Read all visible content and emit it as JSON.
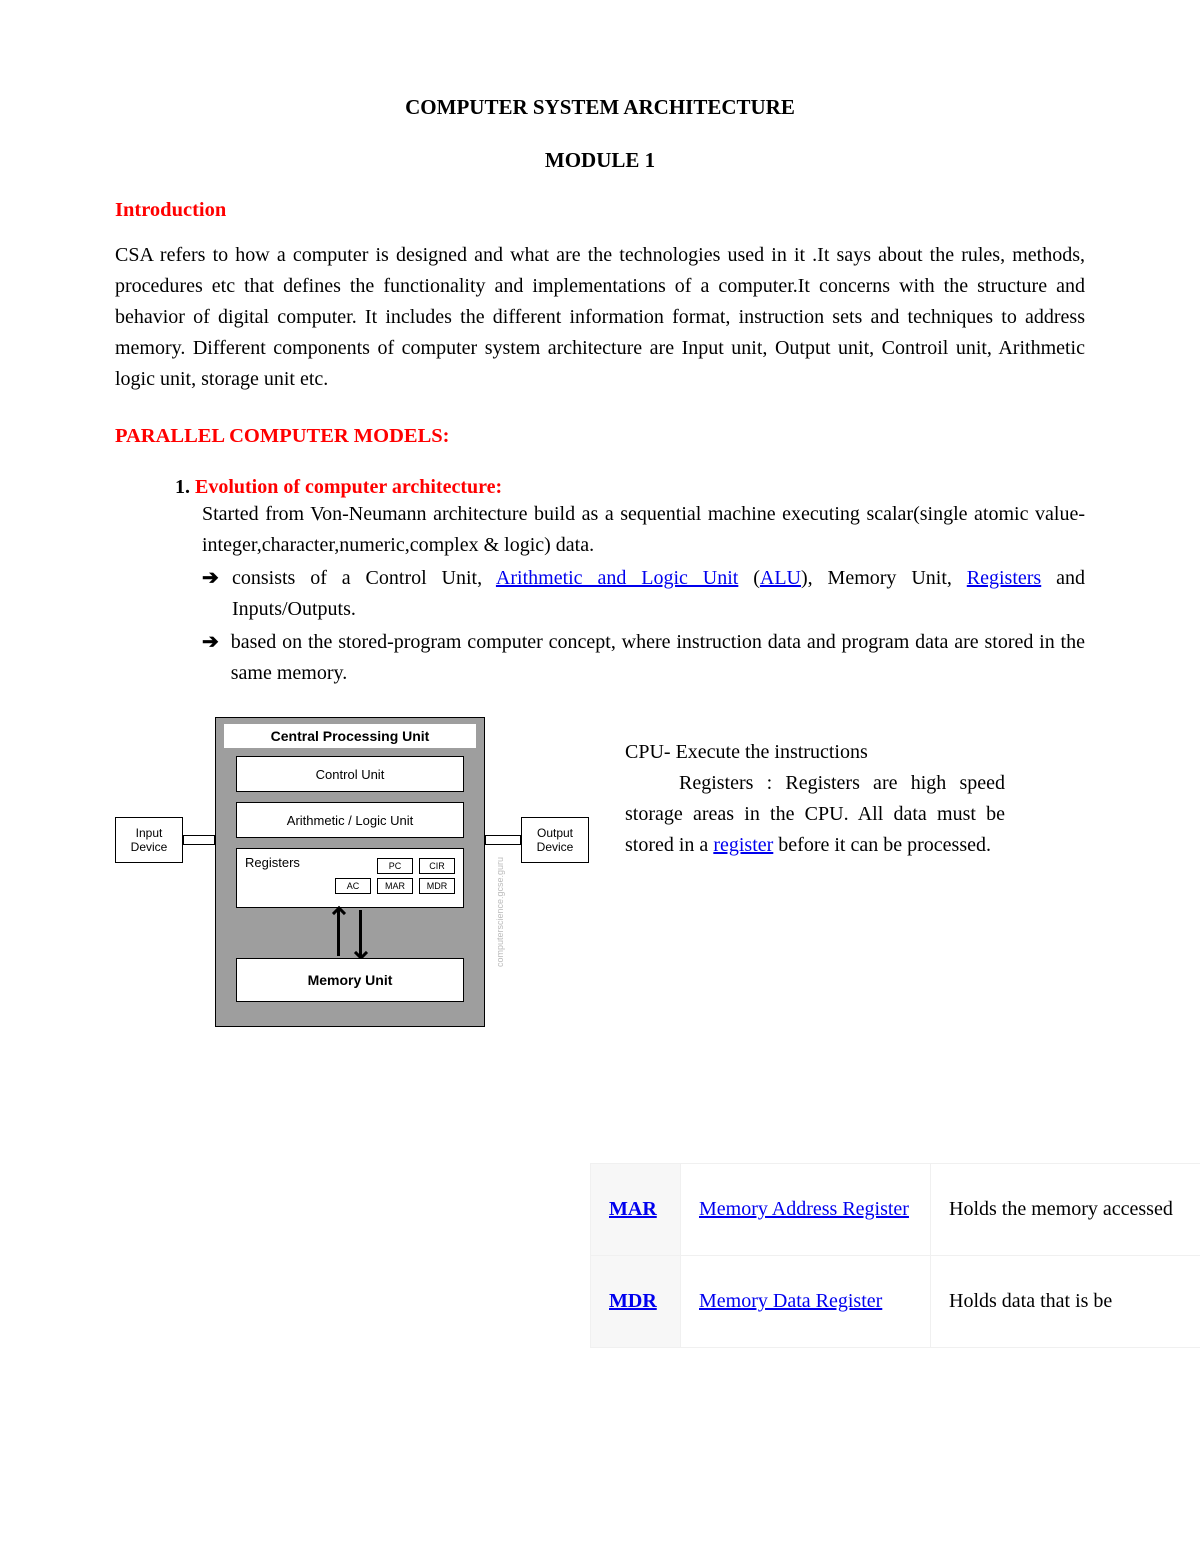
{
  "title": "COMPUTER SYSTEM ARCHITECTURE",
  "module": "MODULE 1",
  "sections": {
    "intro_heading": "Introduction",
    "intro_para": "CSA refers to  how  a computer is designed and what are the technologies used in it .It says about the rules, methods, procedures etc that defines the functionality and implementations of a computer.It concerns with the structure and behavior of digital computer. It includes the different information format, instruction sets and techniques to address memory. Different components of computer system architecture are Input unit, Output unit, Controil unit, Arithmetic logic unit, storage unit etc.",
    "parallel_heading": "PARALLEL COMPUTER MODELS:",
    "evolution": {
      "num": "1.",
      "title": "Evolution of computer architecture:",
      "para": "Started from Von-Neumann architecture build as a sequential machine executing scalar(single atomic value-integer,character,numeric,complex & logic) data.",
      "bullet1_pre": "consists of    a Control    Unit, ",
      "bullet1_link1": "Arithmetic    and    Logic    Unit",
      "bullet1_mid1": " (",
      "bullet1_link2": "ALU",
      "bullet1_mid2": "),    Memory Unit, ",
      "bullet1_link3": "Registers",
      "bullet1_post": " and Inputs/Outputs.",
      "bullet2": "based on the stored-program computer concept, where instruction data and program data are stored in the same memory."
    }
  },
  "diagram": {
    "cpu_title": "Central Processing Unit",
    "control_unit": "Control Unit",
    "alu": "Arithmetic / Logic Unit",
    "registers_label": "Registers",
    "reg_pc": "PC",
    "reg_cir": "CIR",
    "reg_ac": "AC",
    "reg_mar": "MAR",
    "reg_mdr": "MDR",
    "memory_unit": "Memory Unit",
    "input_device": "Input\nDevice",
    "output_device": "Output\nDevice",
    "watermark": "computerscience.gcse.guru"
  },
  "side_text": {
    "line1": "CPU- Execute the instructions",
    "line2_pre": "Registers : Registers are high speed storage areas in the CPU.  All data must be stored in a ",
    "line2_link": "register",
    "line2_post": " before   it   can   be processed."
  },
  "table": {
    "row1": {
      "key": "MAR",
      "val": "Memory Address Register",
      "desc": "Holds the memory accessed"
    },
    "row2": {
      "key": "MDR",
      "val": "Memory Data Register",
      "desc": "Holds data that is be"
    }
  }
}
